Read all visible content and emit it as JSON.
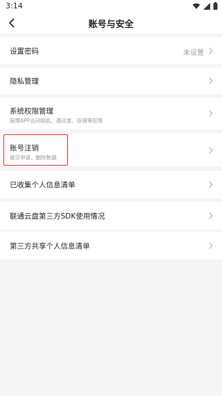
{
  "status_bar": {
    "time": "3:14",
    "icons": [
      "wifi-icon",
      "signal-icon",
      "battery-icon"
    ]
  },
  "header": {
    "title": "账号与安全",
    "back_icon": "chevron-left-icon"
  },
  "settings": {
    "items": [
      {
        "label": "设置密码",
        "value": "未设置",
        "sublabel": ""
      },
      {
        "label": "隐私管理",
        "value": "",
        "sublabel": ""
      },
      {
        "label": "系统权限管理",
        "value": "",
        "sublabel": "管理APP访问相机、通讯录、存储等权限"
      },
      {
        "label": "账号注销",
        "value": "",
        "sublabel": "提交申请，删除数据"
      },
      {
        "label": "已收集个人信息清单",
        "value": "",
        "sublabel": ""
      },
      {
        "label": "联通云盘第三方SDK使用情况",
        "value": "",
        "sublabel": ""
      },
      {
        "label": "第三方共享个人信息清单",
        "value": "",
        "sublabel": ""
      }
    ]
  },
  "colors": {
    "background": "#f5f5f5",
    "card": "#ffffff",
    "highlight": "#e52b2b",
    "secondary_text": "#9a9a9a"
  }
}
